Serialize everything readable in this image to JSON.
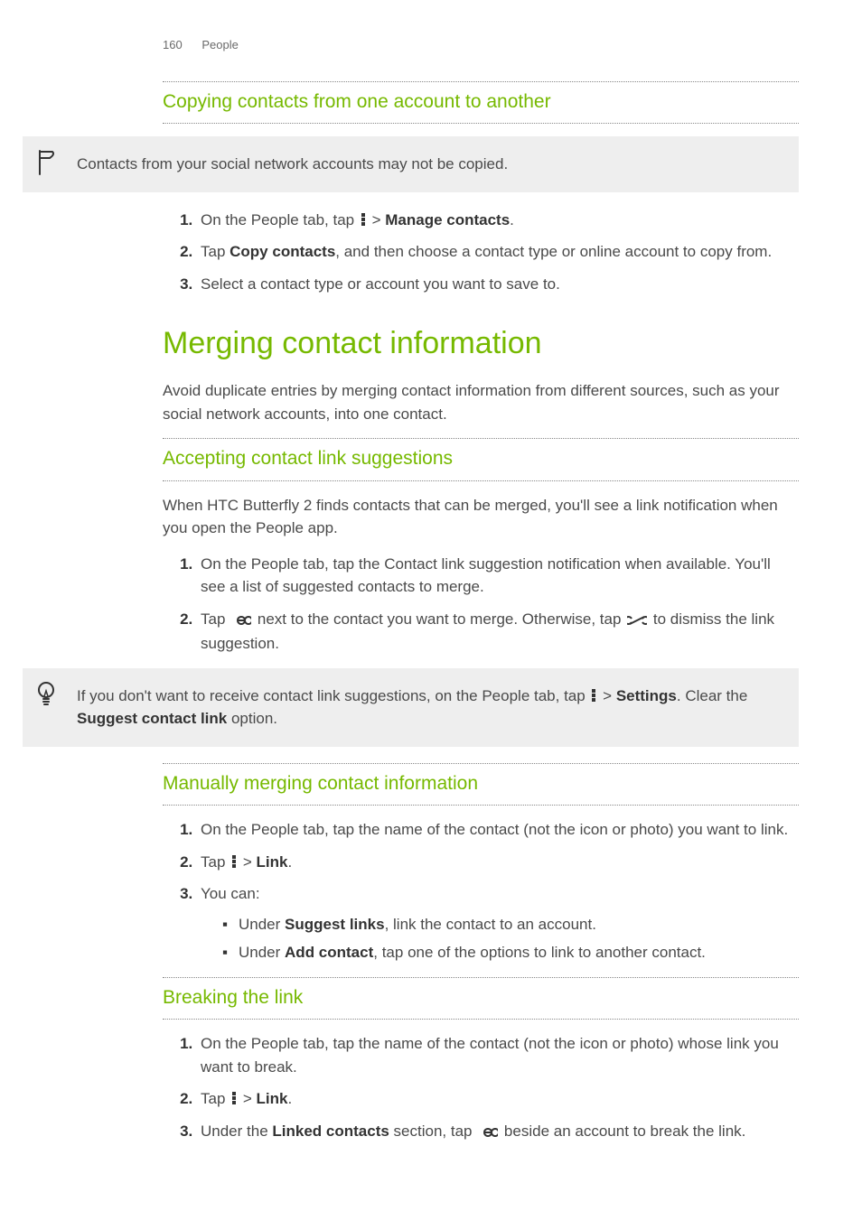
{
  "header": {
    "page_number": "160",
    "section": "People"
  },
  "sec_copy": {
    "title": "Copying contacts from one account to another",
    "callout": "Contacts from your social network accounts may not be copied.",
    "step1_a": "On the People tab, tap ",
    "step1_b": " > ",
    "step1_c": "Manage contacts",
    "step1_d": ".",
    "step2_a": "Tap ",
    "step2_b": "Copy contacts",
    "step2_c": ", and then choose a contact type or online account to copy from.",
    "step3": "Select a contact type or account you want to save to."
  },
  "main_title": "Merging contact information",
  "main_intro": "Avoid duplicate entries by merging contact information from different sources, such as your social network accounts, into one contact.",
  "sec_accept": {
    "title": "Accepting contact link suggestions",
    "intro": "When HTC Butterfly 2 finds contacts that can be merged, you'll see a link notification when you open the People app.",
    "step1": "On the People tab, tap the Contact link suggestion notification when available. You'll see a list of suggested contacts to merge.",
    "step2_a": "Tap ",
    "step2_b": " next to the contact you want to merge. Otherwise, tap ",
    "step2_c": " to dismiss the link suggestion.",
    "tip_a": "If you don't want to receive contact link suggestions, on the People tab, tap ",
    "tip_b": " > ",
    "tip_c": "Settings",
    "tip_d": ". Clear the ",
    "tip_e": "Suggest contact link",
    "tip_f": " option."
  },
  "sec_manual": {
    "title": "Manually merging contact information",
    "step1": "On the People tab, tap the name of the contact (not the icon or photo) you want to link.",
    "step2_a": "Tap ",
    "step2_b": " > ",
    "step2_c": "Link",
    "step2_d": ".",
    "step3": "You can:",
    "sub1_a": "Under ",
    "sub1_b": "Suggest links",
    "sub1_c": ", link the contact to an account.",
    "sub2_a": "Under ",
    "sub2_b": "Add contact",
    "sub2_c": ", tap one of the options to link to another contact."
  },
  "sec_break": {
    "title": "Breaking the link",
    "step1": "On the People tab, tap the name of the contact (not the icon or photo) whose link you want to break.",
    "step2_a": "Tap ",
    "step2_b": " > ",
    "step2_c": "Link",
    "step2_d": ".",
    "step3_a": "Under the ",
    "step3_b": "Linked contacts",
    "step3_c": " section, tap ",
    "step3_d": " beside an account to break the link."
  }
}
